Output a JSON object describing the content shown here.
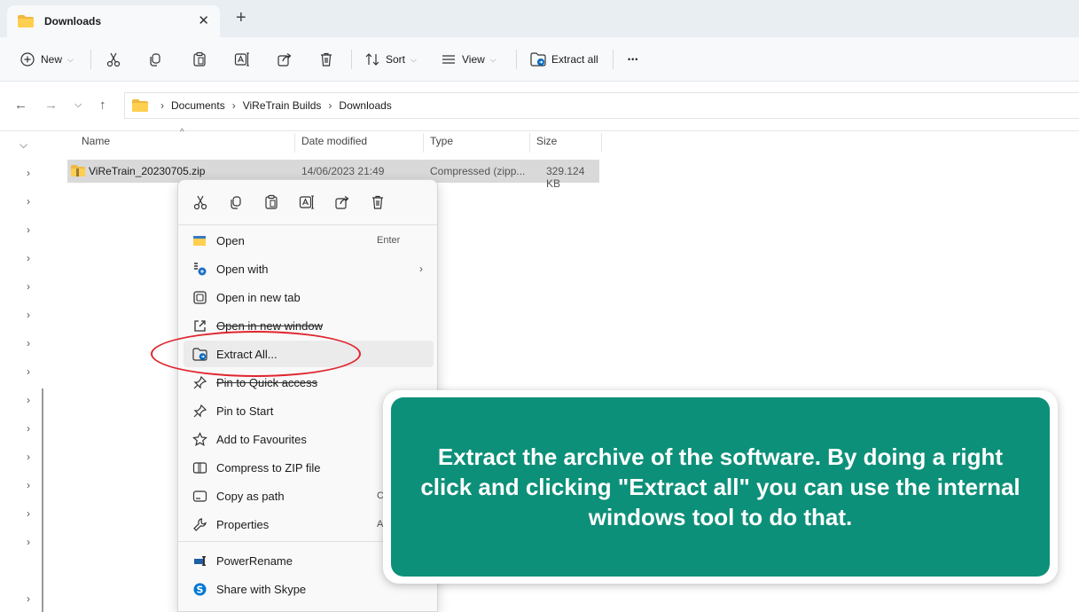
{
  "tab": {
    "title": "Downloads",
    "close": "✕",
    "add": "+"
  },
  "toolbar": {
    "new_label": "New",
    "sort_label": "Sort",
    "view_label": "View",
    "extract_label": "Extract all",
    "more_label": "•••"
  },
  "address": {
    "crumbs": [
      "Documents",
      "ViReTrain Builds",
      "Downloads"
    ]
  },
  "columns": {
    "name": "Name",
    "date": "Date modified",
    "type": "Type",
    "size": "Size"
  },
  "file": {
    "name": "ViReTrain_20230705.zip",
    "date": "14/06/2023 21:49",
    "type": "Compressed (zipp...",
    "size": "329.124 KB"
  },
  "context_menu": {
    "items": [
      {
        "label": "Open",
        "shortcut": "Enter",
        "icon": "folder-open-icon"
      },
      {
        "label": "Open with",
        "shortcut": "",
        "icon": "open-with-icon"
      },
      {
        "label": "Open in new tab",
        "shortcut": "",
        "icon": "new-tab-icon"
      },
      {
        "label": "Open in new window",
        "shortcut": "",
        "icon": "new-window-icon"
      },
      {
        "label": "Extract All...",
        "shortcut": "",
        "icon": "extract-icon"
      },
      {
        "label": "Pin to Quick access",
        "shortcut": "",
        "icon": "pin-icon"
      },
      {
        "label": "Pin to Start",
        "shortcut": "",
        "icon": "pin-icon"
      },
      {
        "label": "Add to Favourites",
        "shortcut": "",
        "icon": "star-icon"
      },
      {
        "label": "Compress to ZIP file",
        "shortcut": "",
        "icon": "zip-icon"
      },
      {
        "label": "Copy as path",
        "shortcut": "Ctrl+",
        "icon": "copy-path-icon"
      },
      {
        "label": "Properties",
        "shortcut": "Alt+",
        "icon": "wrench-icon"
      },
      {
        "label": "PowerRename",
        "shortcut": "",
        "icon": "powerrename-icon"
      },
      {
        "label": "Share with Skype",
        "shortcut": "",
        "icon": "skype-icon"
      }
    ]
  },
  "callout": {
    "text": "Extract the archive of the software. By doing a right click and clicking \"Extract all\" you can use the internal windows tool to do that."
  },
  "colors": {
    "callout": "#0d9079",
    "annotation": "#e0262f",
    "selection": "#d9d9d9"
  }
}
